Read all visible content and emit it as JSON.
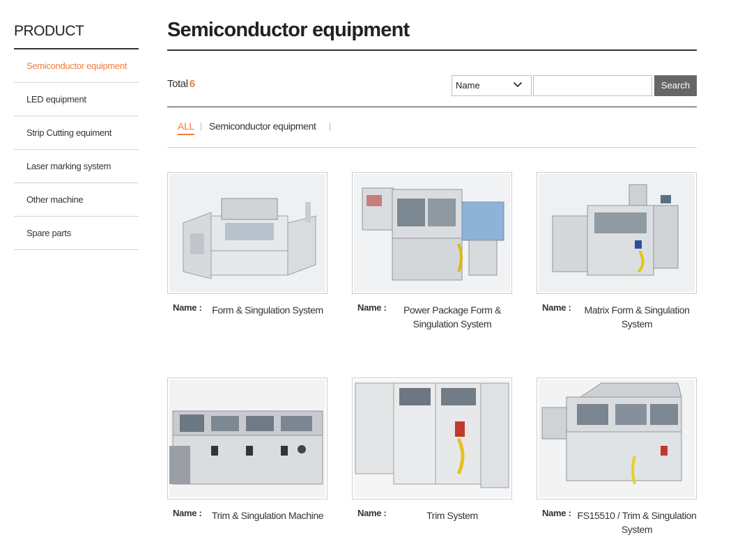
{
  "sidebar": {
    "title": "PRODUCT",
    "items": [
      {
        "label": "Semiconductor equipment",
        "active": true
      },
      {
        "label": "LED equipment",
        "active": false
      },
      {
        "label": "Strip Cutting equiment",
        "active": false
      },
      {
        "label": "Laser marking system",
        "active": false
      },
      {
        "label": "Other machine",
        "active": false
      },
      {
        "label": "Spare parts",
        "active": false
      }
    ]
  },
  "main": {
    "title": "Semiconductor equipment",
    "total_label": "Total",
    "total_count": "6",
    "search": {
      "field_selected": "Name",
      "input_value": "",
      "button_label": "Search"
    },
    "tabs": [
      {
        "label": "ALL",
        "active": true
      },
      {
        "label": "Semiconductor equipment",
        "active": false
      }
    ]
  },
  "products": [
    {
      "name_label": "Name :",
      "name": "Form & Singulation System"
    },
    {
      "name_label": "Name :",
      "name": "Power Package Form & Singulation System"
    },
    {
      "name_label": "Name :",
      "name": "Matrix Form & Singulation System"
    },
    {
      "name_label": "Name :",
      "name": "Trim & Singulation Machine"
    },
    {
      "name_label": "Name :",
      "name": "Trim System"
    },
    {
      "name_label": "Name :",
      "name": "FS15510 / Trim & Singulation System"
    }
  ],
  "colors": {
    "accent": "#ef7d3c",
    "button": "#666666",
    "rule": "#333333"
  }
}
